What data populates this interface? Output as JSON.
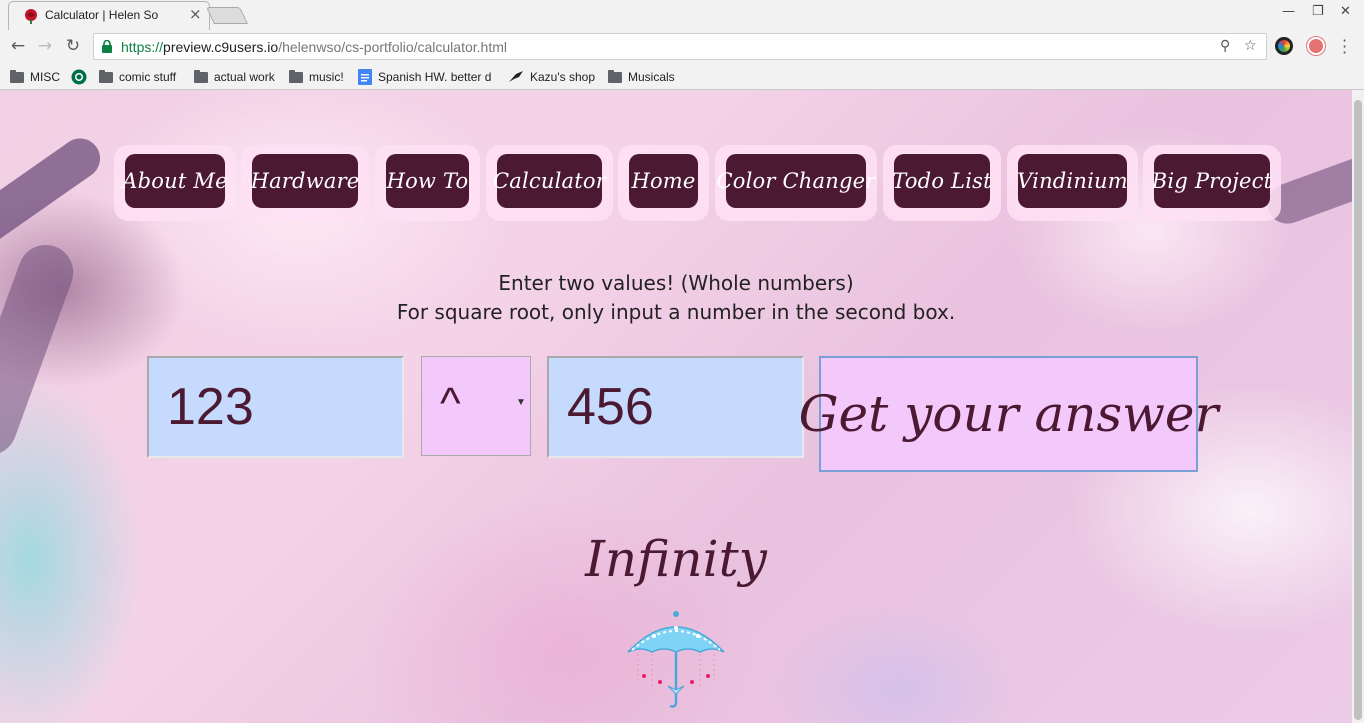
{
  "browser": {
    "tab_title": "Calculator | Helen So",
    "url_scheme": "https://",
    "url_host": "preview.c9users.io",
    "url_path": "/helenwso/cs-portfolio/calculator.html",
    "bookmarks": [
      {
        "label": "MISC",
        "icon": "folder-icon"
      },
      {
        "label": "",
        "icon": "starbucks-icon"
      },
      {
        "label": "comic stuff",
        "icon": "folder-icon"
      },
      {
        "label": "actual work",
        "icon": "folder-icon"
      },
      {
        "label": "music!",
        "icon": "folder-icon"
      },
      {
        "label": "Spanish HW. better d",
        "icon": "docs-icon"
      },
      {
        "label": "Kazu's shop",
        "icon": "bird-icon"
      },
      {
        "label": "Musicals",
        "icon": "folder-icon"
      }
    ]
  },
  "page": {
    "nav": [
      {
        "label": "About Me"
      },
      {
        "label": "Hardware"
      },
      {
        "label": "How To"
      },
      {
        "label": "Calculator"
      },
      {
        "label": "Home"
      },
      {
        "label": "Color Changer"
      },
      {
        "label": "Todo List"
      },
      {
        "label": "Vindinium"
      },
      {
        "label": "Big Project"
      }
    ],
    "instructions_line1": "Enter two values! (Whole numbers)",
    "instructions_line2": "For square root, only input a number in the second box.",
    "input1_value": "123",
    "operator_value": "^",
    "input2_value": "456",
    "answer_button": "Get your answer",
    "result": "Infinity"
  },
  "colors": {
    "nav_button": "#4b1932",
    "input_bg": "#c5dafc",
    "button_bg": "#f3c8fb",
    "text_accent": "#4b1932"
  }
}
